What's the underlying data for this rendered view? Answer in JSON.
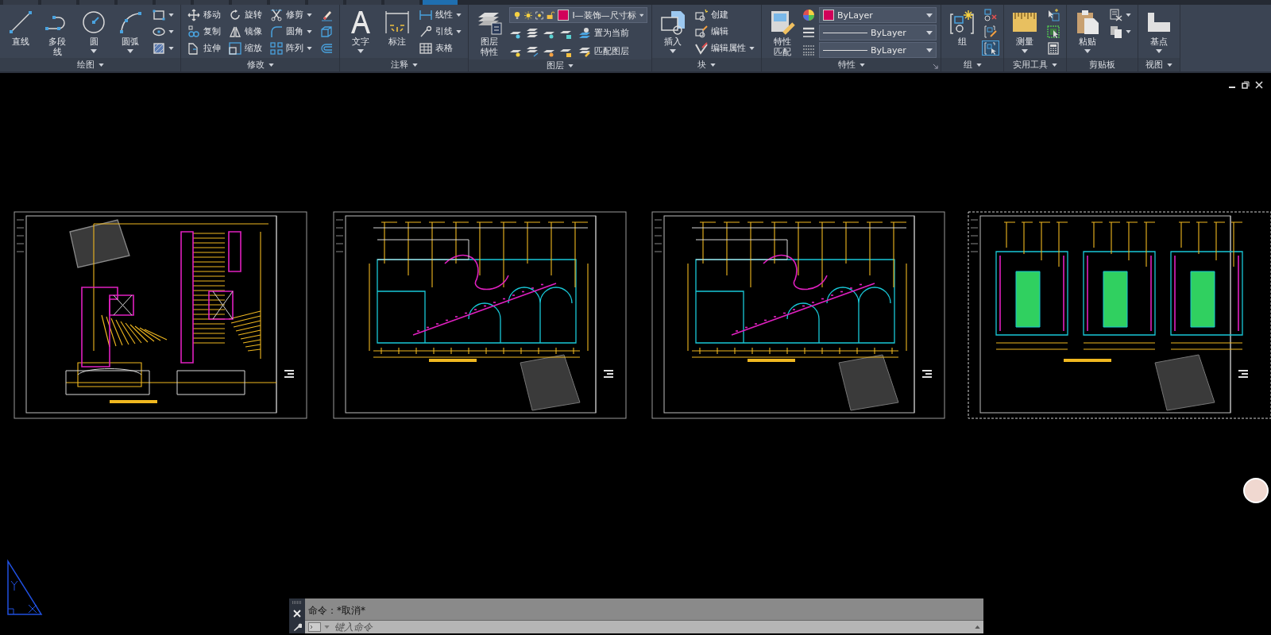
{
  "ribbon_tabs": [
    {
      "selected": false
    },
    {
      "selected": false
    },
    {
      "selected": false
    },
    {
      "selected": false
    },
    {
      "selected": false
    },
    {
      "selected": false
    },
    {
      "selected": false
    },
    {
      "selected": false
    },
    {
      "selected": false
    },
    {
      "selected": false
    },
    {
      "selected": false
    },
    {
      "selected": true
    }
  ],
  "ribbon_panels": [
    {
      "title": "绘图",
      "menu": true,
      "launcher": false,
      "groups": [
        {
          "kind": "large",
          "label": "直线",
          "dropdown": false
        },
        {
          "kind": "large",
          "label": "多段线",
          "dropdown": false
        },
        {
          "kind": "large",
          "label": "圆",
          "dropdown": true
        },
        {
          "kind": "large",
          "label": "圆弧",
          "dropdown": true
        },
        {
          "kind": "icons",
          "items": [
            {
              "dropdown": true,
              "on": false
            },
            {
              "dropdown": true,
              "on": false
            },
            {
              "dropdown": true,
              "on": false
            }
          ]
        }
      ]
    },
    {
      "title": "修改",
      "menu": true,
      "launcher": false,
      "groups": [
        {
          "kind": "stack",
          "items": [
            {
              "label": "移动",
              "dropdown": false
            },
            {
              "label": "复制",
              "dropdown": false
            },
            {
              "label": "拉伸",
              "dropdown": false
            }
          ]
        },
        {
          "kind": "stack",
          "items": [
            {
              "label": "旋转",
              "dropdown": false
            },
            {
              "label": "镜像",
              "dropdown": false
            },
            {
              "label": "缩放",
              "dropdown": false
            }
          ]
        },
        {
          "kind": "stack",
          "items": [
            {
              "label": "修剪",
              "dropdown": true
            },
            {
              "label": "圆角",
              "dropdown": true
            },
            {
              "label": "阵列",
              "dropdown": true
            }
          ]
        },
        {
          "kind": "icons",
          "items": [
            {
              "dropdown": false,
              "on": false
            },
            {
              "dropdown": false,
              "on": false
            },
            {
              "dropdown": false,
              "on": false
            }
          ]
        }
      ]
    },
    {
      "title": "注释",
      "menu": true,
      "launcher": false,
      "groups": [
        {
          "kind": "large",
          "label": "文字",
          "dropdown": true
        },
        {
          "kind": "large",
          "label": "标注",
          "dropdown": false
        },
        {
          "kind": "stack",
          "items": [
            {
              "label": "线性",
              "dropdown": true
            },
            {
              "label": "引线",
              "dropdown": true
            },
            {
              "label": "表格",
              "dropdown": false
            }
          ]
        }
      ]
    },
    {
      "title": "图层",
      "menu": true,
      "launcher": false,
      "groups": [
        {
          "kind": "large",
          "label": "图层特性",
          "dropdown": false
        },
        {
          "kind": "layers",
          "combo": {
            "value": "I—装饰—尺寸标",
            "color": "#d1005a"
          },
          "rows": [
            {
              "label": "置为当前"
            },
            {
              "label": "匹配图层"
            }
          ]
        }
      ]
    },
    {
      "title": "块",
      "menu": true,
      "launcher": false,
      "groups": [
        {
          "kind": "large",
          "label": "插入",
          "dropdown": true
        },
        {
          "kind": "stack",
          "items": [
            {
              "label": "创建",
              "dropdown": false
            },
            {
              "label": "编辑",
              "dropdown": false
            },
            {
              "label": "编辑属性",
              "dropdown": true
            }
          ]
        }
      ]
    },
    {
      "title": "特性",
      "menu": true,
      "launcher": true,
      "groups": [
        {
          "kind": "large",
          "label": "特性匹配",
          "dropdown": false
        },
        {
          "kind": "props",
          "combos": [
            {
              "kind": "color",
              "value": "ByLayer",
              "color": "#d1005a"
            },
            {
              "kind": "line",
              "value": "ByLayer"
            },
            {
              "kind": "line",
              "value": "ByLayer"
            }
          ]
        }
      ]
    },
    {
      "title": "组",
      "menu": true,
      "launcher": false,
      "groups": [
        {
          "kind": "large",
          "label": "组",
          "dropdown": false
        },
        {
          "kind": "icons",
          "items": [
            {
              "dropdown": false,
              "on": false
            },
            {
              "dropdown": false,
              "on": false
            },
            {
              "dropdown": false,
              "on": true
            }
          ]
        }
      ]
    },
    {
      "title": "实用工具",
      "menu": true,
      "launcher": false,
      "groups": [
        {
          "kind": "large",
          "label": "测量",
          "dropdown": true
        },
        {
          "kind": "icons",
          "items": [
            {
              "dropdown": false,
              "on": false
            },
            {
              "dropdown": false,
              "on": false
            },
            {
              "dropdown": false,
              "on": false
            }
          ]
        }
      ]
    },
    {
      "title": "剪贴板",
      "menu": false,
      "launcher": false,
      "groups": [
        {
          "kind": "large",
          "label": "粘贴",
          "dropdown": true
        },
        {
          "kind": "icons",
          "items": [
            {
              "dropdown": true,
              "on": false
            },
            {
              "dropdown": true,
              "on": false
            }
          ]
        }
      ]
    },
    {
      "title": "视图",
      "menu": true,
      "launcher": false,
      "groups": [
        {
          "kind": "large",
          "label": "基点",
          "dropdown": true
        }
      ]
    }
  ],
  "drawing": {
    "sheets": [
      {
        "kind": "plan",
        "selected": false
      },
      {
        "kind": "elevation",
        "selected": false
      },
      {
        "kind": "elevation",
        "selected": false
      },
      {
        "kind": "sections",
        "selected": true
      }
    ]
  },
  "command_line": {
    "history": "命令：*取消*",
    "placeholder": "键入命令"
  }
}
